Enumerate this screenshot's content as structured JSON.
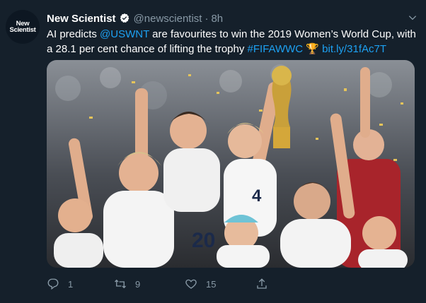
{
  "avatar": {
    "line1": "New",
    "line2": "Scientist"
  },
  "tweet": {
    "display_name": "New Scientist",
    "handle": "@newscientist",
    "separator": "·",
    "time": "8h",
    "text_1": "AI predicts ",
    "mention": "@USWNT",
    "text_2": " are favourites to win the 2019 Women’s World Cup,  with a 28.1 per cent chance of lifting the trophy ",
    "hashtag": "#FIFAWWC",
    "emoji": "🏆",
    "url": "bit.ly/31fAc7T"
  },
  "photo": {
    "jersey_numbers": [
      "20",
      "4"
    ]
  },
  "actions": {
    "reply_count": "1",
    "retweet_count": "9",
    "like_count": "15"
  },
  "colors": {
    "background": "#15202b",
    "link": "#1da1f2",
    "muted": "#8899a6",
    "verified": "#ffffff"
  },
  "icons": {
    "verified": "verified-badge-icon",
    "caret": "chevron-down-icon",
    "reply": "reply-icon",
    "retweet": "retweet-icon",
    "like": "heart-icon",
    "share": "share-icon"
  }
}
